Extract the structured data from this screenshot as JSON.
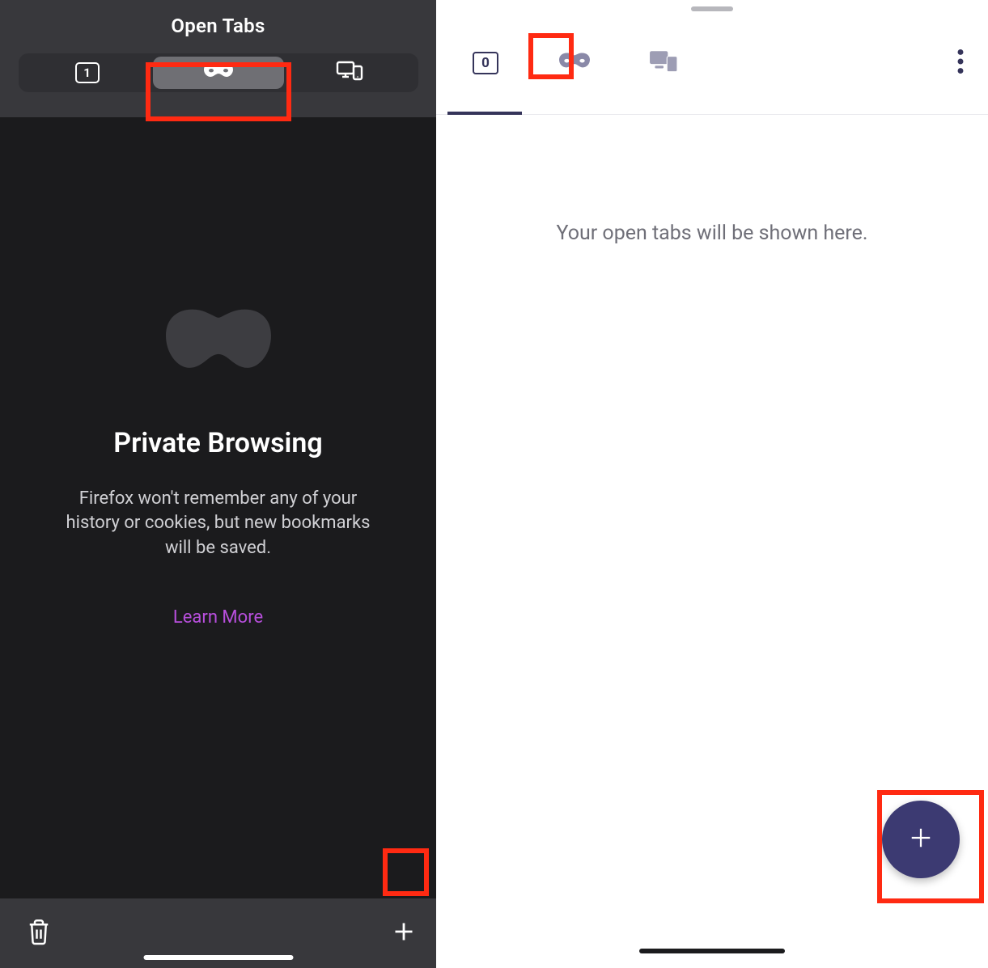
{
  "left": {
    "title": "Open Tabs",
    "tab_count": "1",
    "private": {
      "heading": "Private Browsing",
      "description": "Firefox won't remember any of your history or cookies, but new bookmarks will be saved.",
      "learn_more": "Learn More"
    }
  },
  "right": {
    "tab_count": "0",
    "empty_message": "Your open tabs will be shown here."
  }
}
